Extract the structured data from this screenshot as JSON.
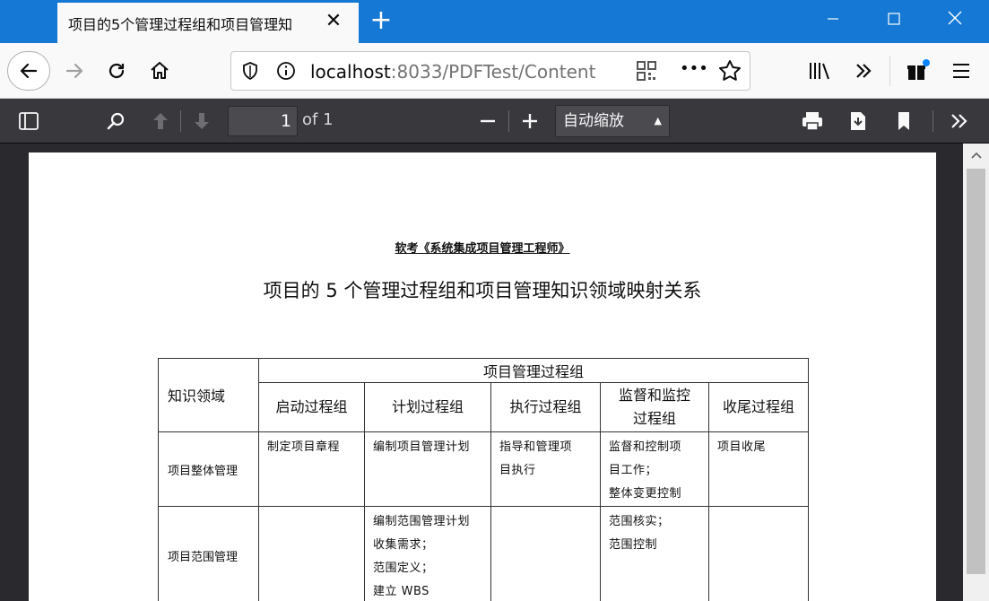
{
  "tab": {
    "title": "项目的5个管理过程组和项目管理知",
    "close": "✕"
  },
  "newtab": "+",
  "window": {
    "minimize": "—",
    "maximize": "☐",
    "close": "✕"
  },
  "nav": {
    "url_host": "localhost",
    "url_rest": ":8033/PDFTest/Content",
    "more": "•••"
  },
  "pdf_toolbar": {
    "page_number": "1",
    "page_count": "of 1",
    "zoom": "自动缩放"
  },
  "document": {
    "header": "软考《系统集成项目管理工程师》",
    "title": "项目的 5 个管理过程组和项目管理知识领域映射关系",
    "table": {
      "area_header": "知识领域",
      "group_header": "项目管理过程组",
      "columns": [
        "启动过程组",
        "计划过程组",
        "执行过程组",
        "监督和监控过程组",
        "收尾过程组"
      ],
      "rows": [
        {
          "area": "项目整体管理",
          "cells": [
            [
              "制定项目章程"
            ],
            [
              "编制项目管理计划"
            ],
            [
              "指导和管理项",
              "目执行"
            ],
            [
              "监督和控制项",
              "目工作；",
              "整体变更控制"
            ],
            [
              "项目收尾"
            ]
          ]
        },
        {
          "area": "项目范围管理",
          "cells": [
            [],
            [
              "编制范围管理计划",
              "收集需求；",
              "范围定义；",
              "建立 WBS"
            ],
            [],
            [
              "范围核实；",
              "范围控制"
            ],
            []
          ]
        }
      ]
    }
  }
}
